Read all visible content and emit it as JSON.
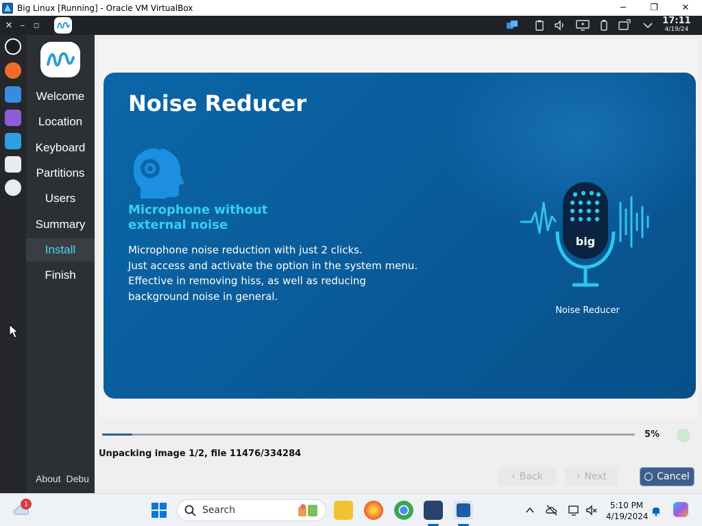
{
  "vbox_window": {
    "title": "Big Linux [Running] - Oracle VM VirtualBox",
    "controls": {
      "minimize": "─",
      "restore": "❐",
      "close": "✕"
    }
  },
  "guest_panel": {
    "buttons": {
      "close": "✕",
      "minimize": "–",
      "maximize": "◻"
    },
    "clock": {
      "time": "17:11",
      "date": "4/19/24"
    },
    "tray_icons": [
      "workspace-icon",
      "clipboard-icon",
      "volume-icon",
      "display-icon",
      "battery-icon",
      "screenshot-icon",
      "chevron-down-icon"
    ]
  },
  "installer": {
    "steps": [
      "Welcome",
      "Location",
      "Keyboard",
      "Partitions",
      "Users",
      "Summary",
      "Install",
      "Finish"
    ],
    "active_step": "Install",
    "footer": {
      "about": "About",
      "debug": "Debu"
    },
    "slide": {
      "title": "Noise Reducer",
      "subtitle_line1": "Microphone without",
      "subtitle_line2": "external noise",
      "body_lines": [
        "Microphone noise reduction with just 2 clicks.",
        "Just access and activate the option in the system menu.",
        "Effective in removing hiss, as well as reducing",
        "background noise in general."
      ],
      "illustration_caption": "Noise Reducer",
      "logo_text": "big"
    },
    "progress": {
      "percent_label": "5%",
      "fraction": 0.056
    },
    "status": "Unpacking image 1/2, file 11476/334284",
    "buttons": {
      "back": "Back",
      "next": "Next",
      "cancel": "Cancel"
    }
  },
  "host_taskbar": {
    "weather_badge": "1",
    "search_placeholder": "Search",
    "apps": [
      "start-icon",
      "file-explorer-icon",
      "firefox-icon",
      "chrome-icon",
      "virtualbox-icon",
      "biglinux-vm-icon"
    ],
    "time": "5:10 PM",
    "date": "4/19/2024"
  },
  "colors": {
    "slide_blue": "#0a5c9b",
    "accent_cyan": "#35d0ee",
    "cancel_blue": "#3d5f8a"
  }
}
